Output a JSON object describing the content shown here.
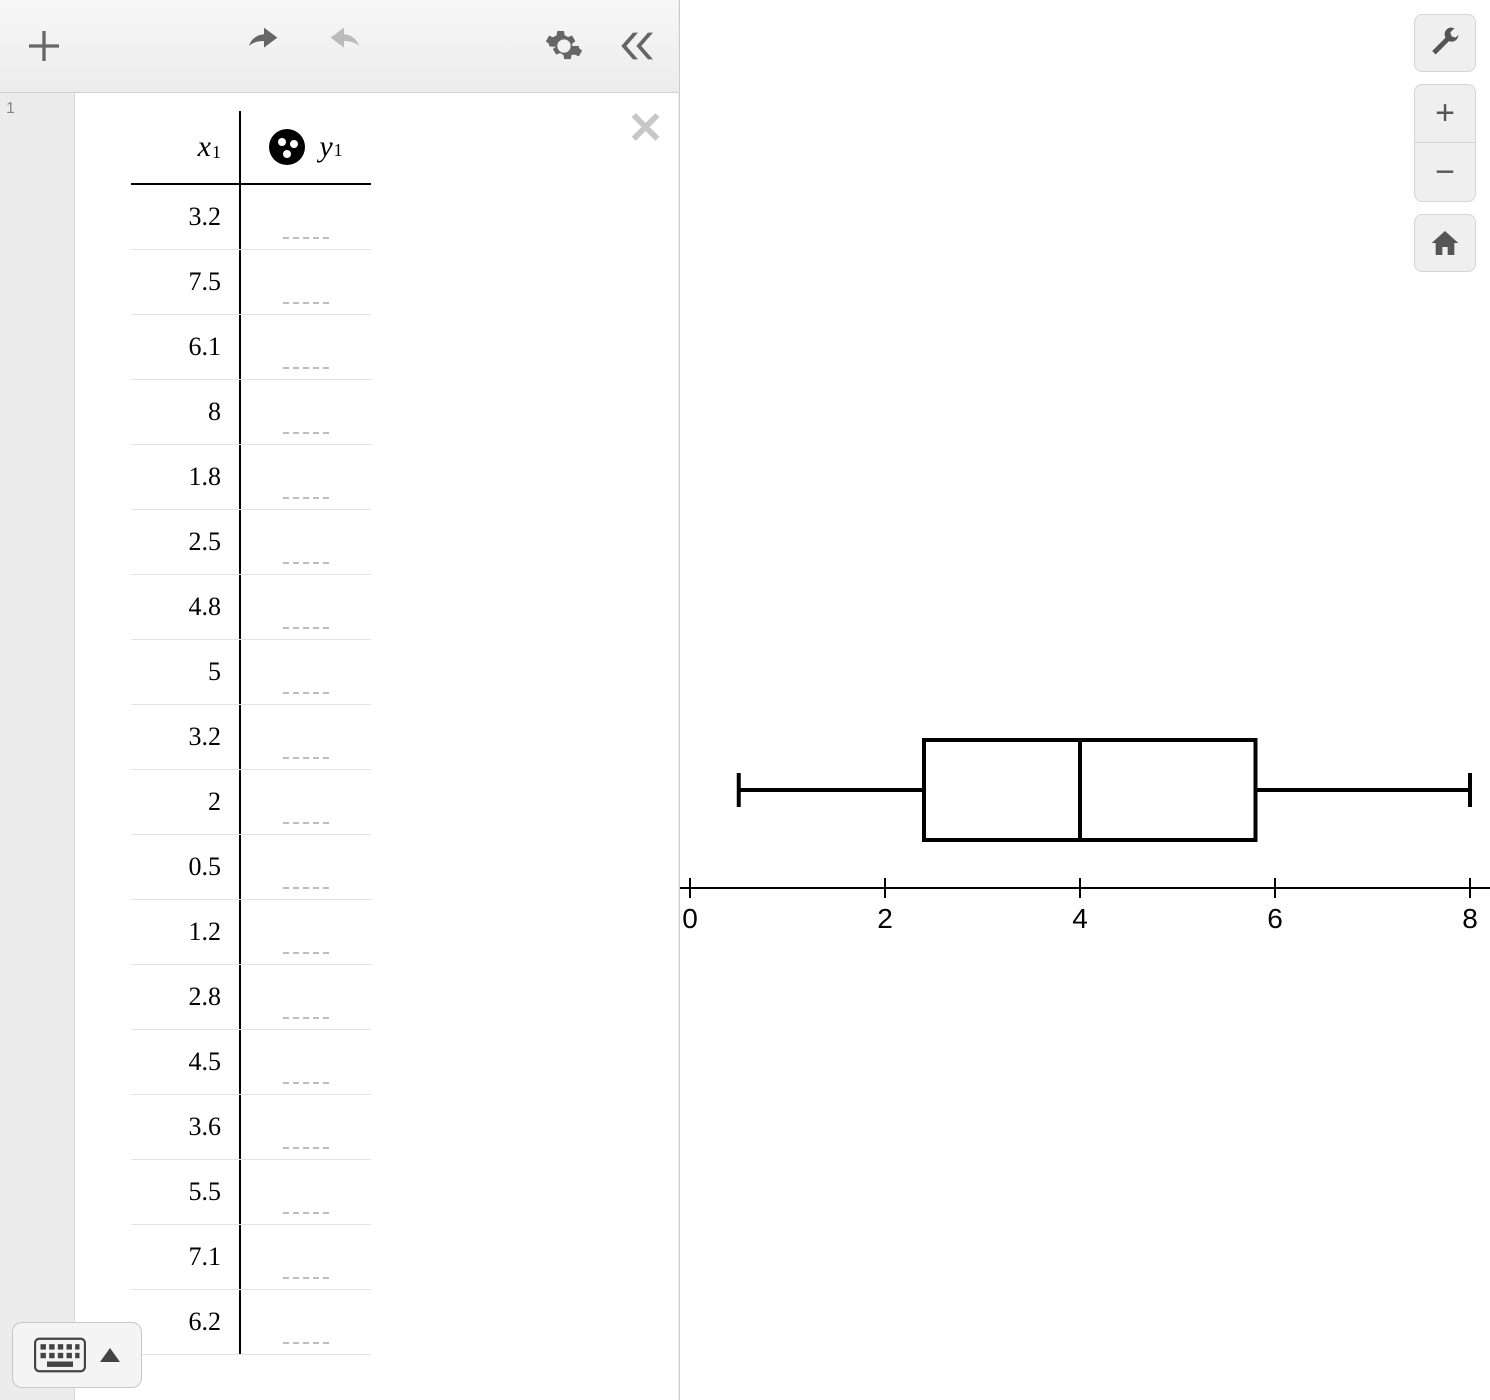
{
  "row_index": "1",
  "table": {
    "x_header": "x",
    "x_sub": "1",
    "y_header": "y",
    "y_sub": "1",
    "x_values": [
      "3.2",
      "7.5",
      "6.1",
      "8",
      "1.8",
      "2.5",
      "4.8",
      "5",
      "3.2",
      "2",
      "0.5",
      "1.2",
      "2.8",
      "4.5",
      "3.6",
      "5.5",
      "7.1",
      "6.2"
    ]
  },
  "chart_data": {
    "type": "boxplot",
    "title": "",
    "xlabel": "",
    "ylabel": "",
    "xlim": [
      0,
      8
    ],
    "x_ticks": [
      0,
      2,
      4,
      6,
      8
    ],
    "min": 0.5,
    "q1": 2.4,
    "median": 4.0,
    "q3": 5.8,
    "max": 8.0,
    "raw_values": [
      3.2,
      7.5,
      6.1,
      8,
      1.8,
      2.5,
      4.8,
      5,
      3.2,
      2,
      0.5,
      1.2,
      2.8,
      4.5,
      3.6,
      5.5,
      7.1,
      6.2
    ]
  }
}
